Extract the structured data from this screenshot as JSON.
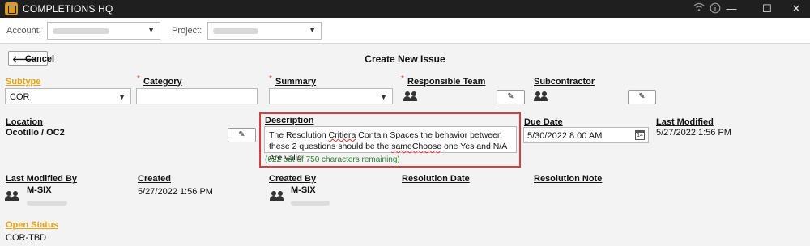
{
  "app": {
    "title": "COMPLETIONS HQ"
  },
  "window_controls": {
    "minimize": "—",
    "maximize": "☐",
    "close": "✕"
  },
  "filters": {
    "account_label": "Account:",
    "project_label": "Project:"
  },
  "header": {
    "cancel_label": "Cancel",
    "page_title": "Create New Issue"
  },
  "fields": {
    "subtype": {
      "label": "Subtype",
      "value": "COR"
    },
    "category": {
      "label": "Category",
      "value": ""
    },
    "summary": {
      "label": "Summary",
      "value": ""
    },
    "responsible_team": {
      "label": "Responsible Team"
    },
    "subcontractor": {
      "label": "Subcontractor"
    },
    "location": {
      "label": "Location",
      "value": "Ocotillo / OC2"
    },
    "description": {
      "label": "Description",
      "text_part1": "The Resolution ",
      "text_misspelled1": "Critiera",
      "text_part2": " Contain Spaces the behavior between these 2 questions should be the ",
      "text_misspelled2": "sameChoose",
      "text_part3": " one Yes and N/A Are valid",
      "remaining": "(622 out of 750 characters remaining)"
    },
    "due_date": {
      "label": "Due Date",
      "value": "5/30/2022 8:00 AM",
      "calendar_glyph": "14"
    },
    "last_modified": {
      "label": "Last Modified",
      "value": "5/27/2022 1:56 PM"
    },
    "last_modified_by": {
      "label": "Last Modified By",
      "value": "M-SIX"
    },
    "created": {
      "label": "Created",
      "value": "5/27/2022 1:56 PM"
    },
    "created_by": {
      "label": "Created By",
      "value": "M-SIX"
    },
    "resolution_date": {
      "label": "Resolution Date"
    },
    "resolution_note": {
      "label": "Resolution Note"
    },
    "open_status": {
      "label": "Open Status",
      "value": "COR-TBD"
    }
  },
  "icons": {
    "app": "completions-logo-icon",
    "wifi": "wifi-icon",
    "info": "info-icon",
    "back": "arrow-left-icon",
    "edit": "pencil-icon",
    "team": "people-icon",
    "calendar": "calendar-icon",
    "dropdown": "chevron-down-icon"
  },
  "colors": {
    "accent": "#e8a317",
    "required": "#e03030",
    "highlight": "#e03b3b",
    "remaining": "#2e7d32",
    "titlebar": "#1f1f1f"
  }
}
